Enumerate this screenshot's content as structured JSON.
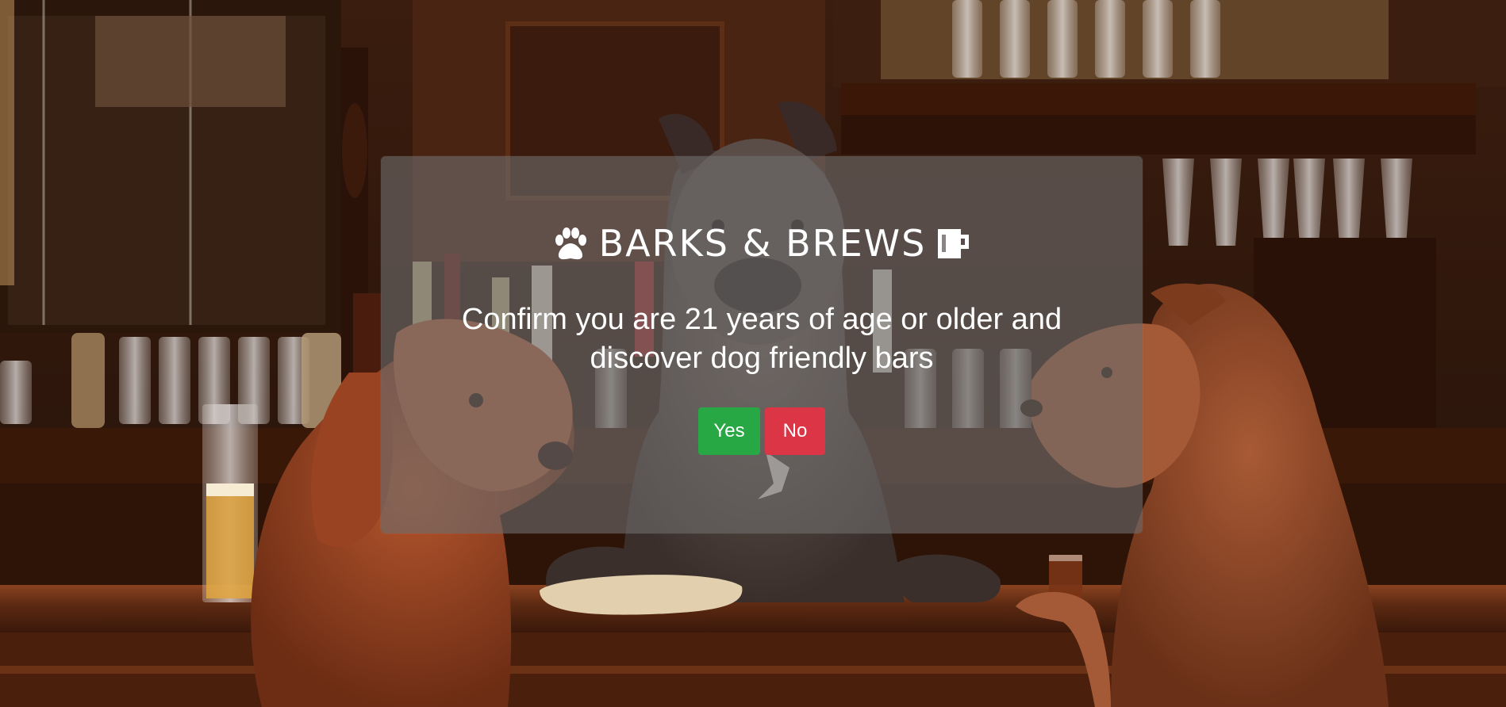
{
  "background": {
    "description_icon": "dog-bar-photo"
  },
  "modal": {
    "brand_name": "BARKS & BREWS",
    "brand_left_icon": "paw-icon",
    "brand_right_icon": "beer-mug-icon",
    "message": "Confirm you are 21 years of age or older and discover dog friendly bars",
    "yes_label": "Yes",
    "no_label": "No",
    "colors": {
      "yes": "#28a745",
      "no": "#dc3545"
    }
  }
}
